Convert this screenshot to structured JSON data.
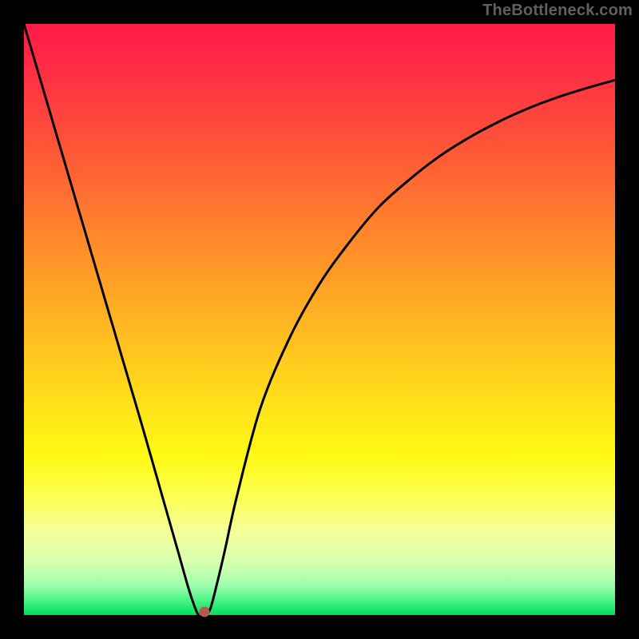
{
  "watermark": "TheBottleneck.com",
  "chart_data": {
    "type": "line",
    "title": "",
    "xlabel": "",
    "ylabel": "",
    "xlim": [
      0,
      1
    ],
    "ylim": [
      0,
      1
    ],
    "series": [
      {
        "name": "curve",
        "x": [
          0.0,
          0.05,
          0.1,
          0.15,
          0.2,
          0.23,
          0.26,
          0.28,
          0.295,
          0.305,
          0.315,
          0.327,
          0.34,
          0.36,
          0.4,
          0.45,
          0.5,
          0.55,
          0.6,
          0.65,
          0.7,
          0.75,
          0.8,
          0.85,
          0.9,
          0.95,
          1.0
        ],
        "y": [
          1.0,
          0.83,
          0.66,
          0.49,
          0.32,
          0.215,
          0.11,
          0.04,
          0.0,
          0.0,
          0.01,
          0.055,
          0.11,
          0.2,
          0.35,
          0.47,
          0.56,
          0.63,
          0.69,
          0.735,
          0.774,
          0.806,
          0.833,
          0.856,
          0.875,
          0.891,
          0.905
        ]
      }
    ],
    "marker": {
      "x": 0.305,
      "y": 0.005
    },
    "background_gradient": {
      "direction": "top-to-bottom",
      "stops": [
        {
          "pos": 0.0,
          "color": "#ff1a47"
        },
        {
          "pos": 0.5,
          "color": "#ffc41f"
        },
        {
          "pos": 0.8,
          "color": "#fdff52"
        },
        {
          "pos": 1.0,
          "color": "#00e05c"
        }
      ]
    }
  }
}
